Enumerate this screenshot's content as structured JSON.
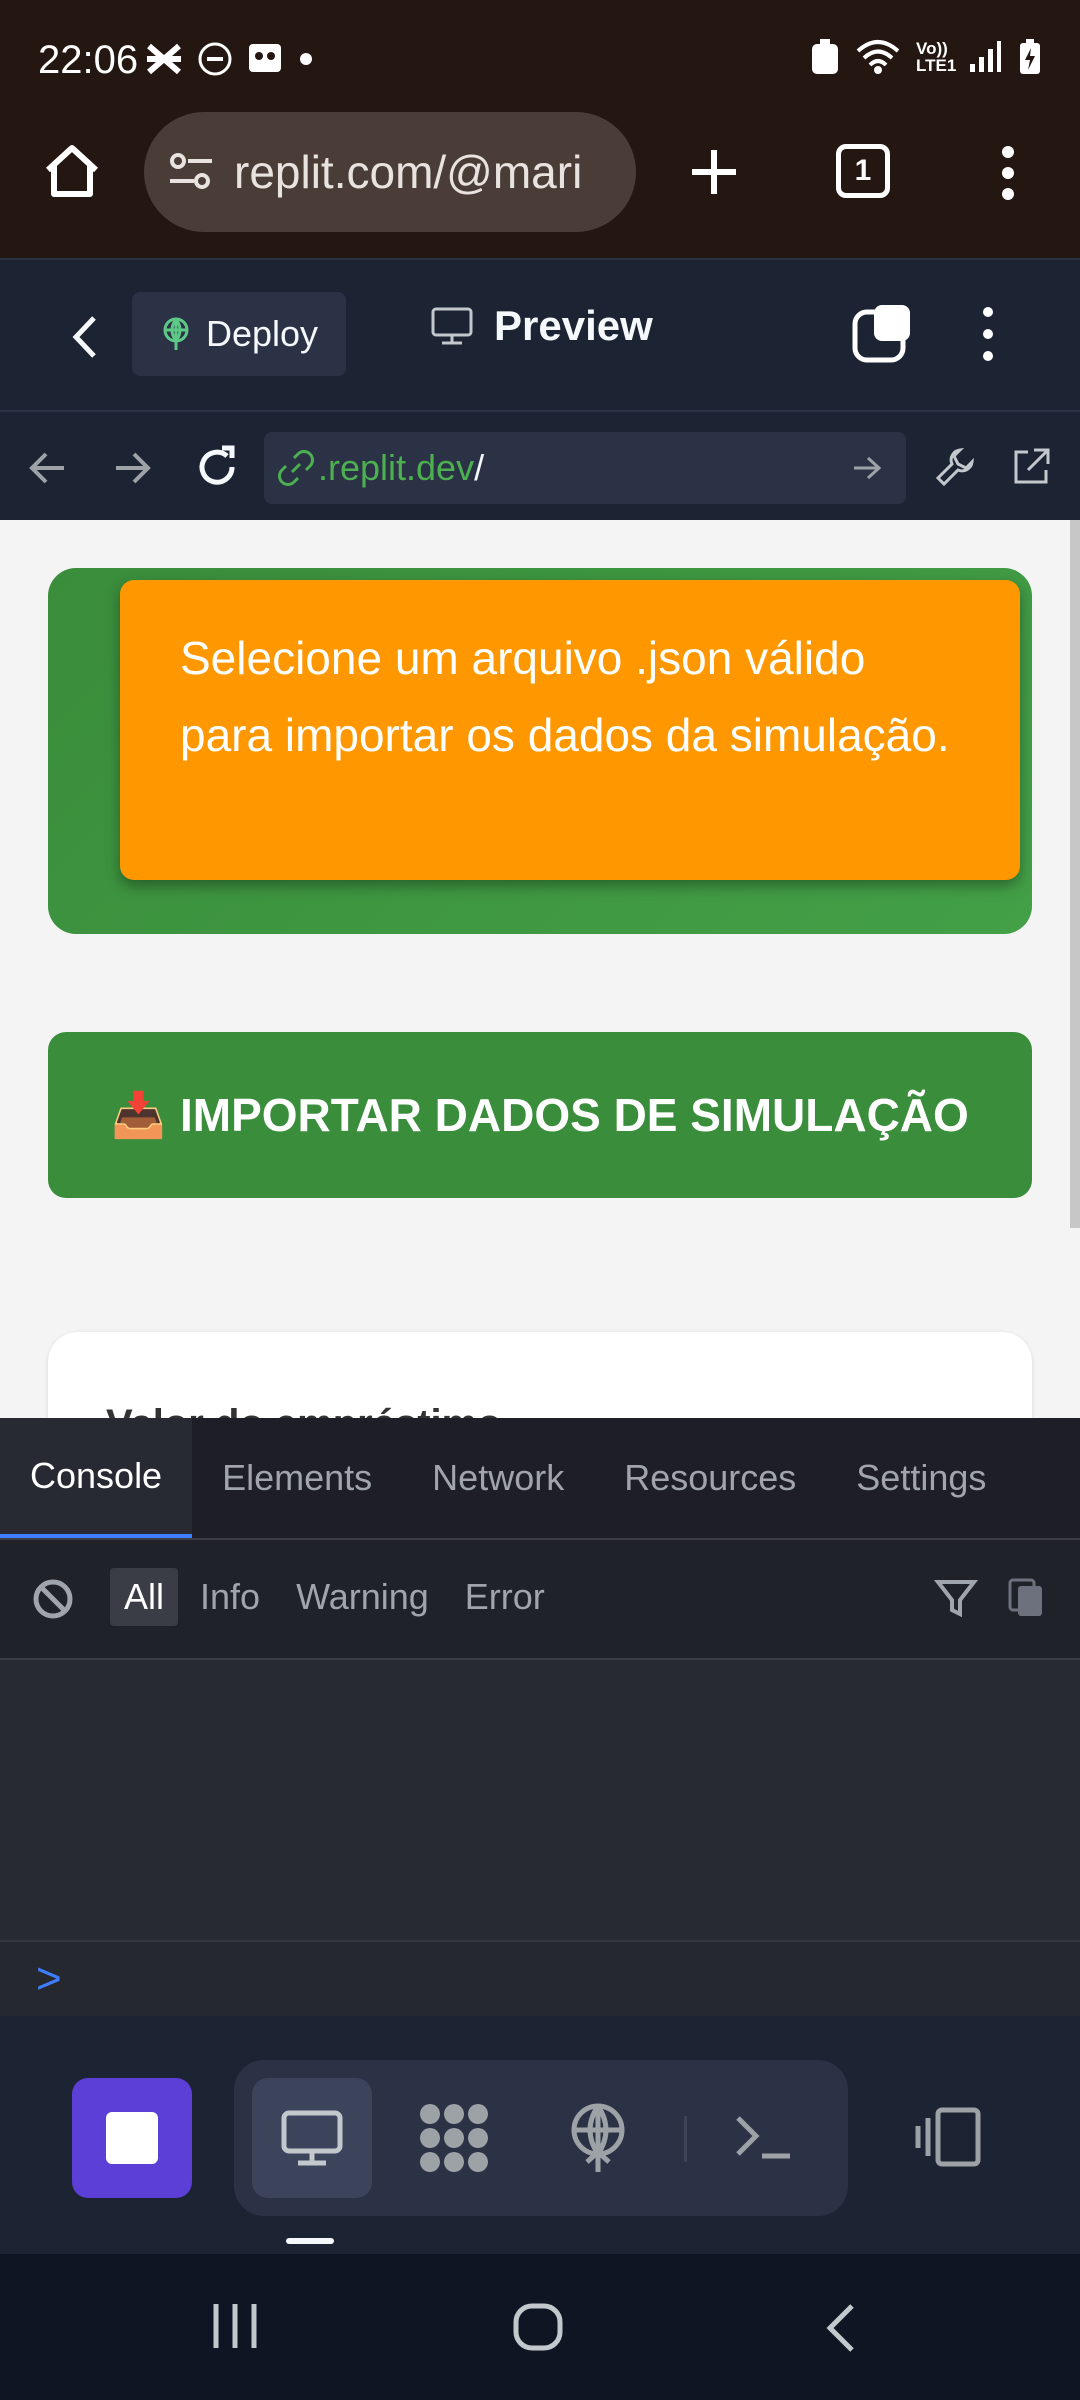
{
  "status_bar": {
    "time": "22:06",
    "network_label": "Vo)) LTE1"
  },
  "browser": {
    "url": "replit.com/@mari",
    "tab_count": "1"
  },
  "replit_header": {
    "deploy_label": "Deploy",
    "preview_label": "Preview"
  },
  "webview": {
    "url_domain": ".replit.dev",
    "url_path": "/"
  },
  "page": {
    "toast_message": "Selecione um arquivo .json válido para importar os dados da simulação.",
    "import_button_label": "IMPORTAR DADOS DE SIMULAÇÃO",
    "import_button_emoji": "📥",
    "card_label_partial": "Valor do empréstimo"
  },
  "devtools": {
    "tabs": [
      "Console",
      "Elements",
      "Network",
      "Resources",
      "Settings"
    ],
    "active_tab": "Console",
    "levels": [
      "All",
      "Info",
      "Warning",
      "Error"
    ],
    "active_level": "All",
    "prompt_symbol": ">"
  },
  "colors": {
    "chrome_bg": "#241712",
    "replit_bg": "#1c2333",
    "toast": "#ff9800",
    "green": "#3a8d3b",
    "stop_button": "#5b3fd6",
    "link_green": "#4caf50"
  },
  "icons": [
    "home-icon",
    "site-settings-icon",
    "new-tab-icon",
    "tab-switcher-icon",
    "more-vert-icon",
    "back-chevron-icon",
    "deploy-icon",
    "monitor-icon",
    "copy-icon",
    "arrow-left-icon",
    "arrow-right-icon",
    "reload-icon",
    "link-icon",
    "go-arrow-icon",
    "wrench-icon",
    "external-link-icon",
    "clear-console-icon",
    "filter-icon",
    "copy-logs-icon",
    "stop-icon",
    "preview-tool-icon",
    "workspace-tool-icon",
    "deploy-tool-icon",
    "shell-tool-icon",
    "devices-icon"
  ]
}
